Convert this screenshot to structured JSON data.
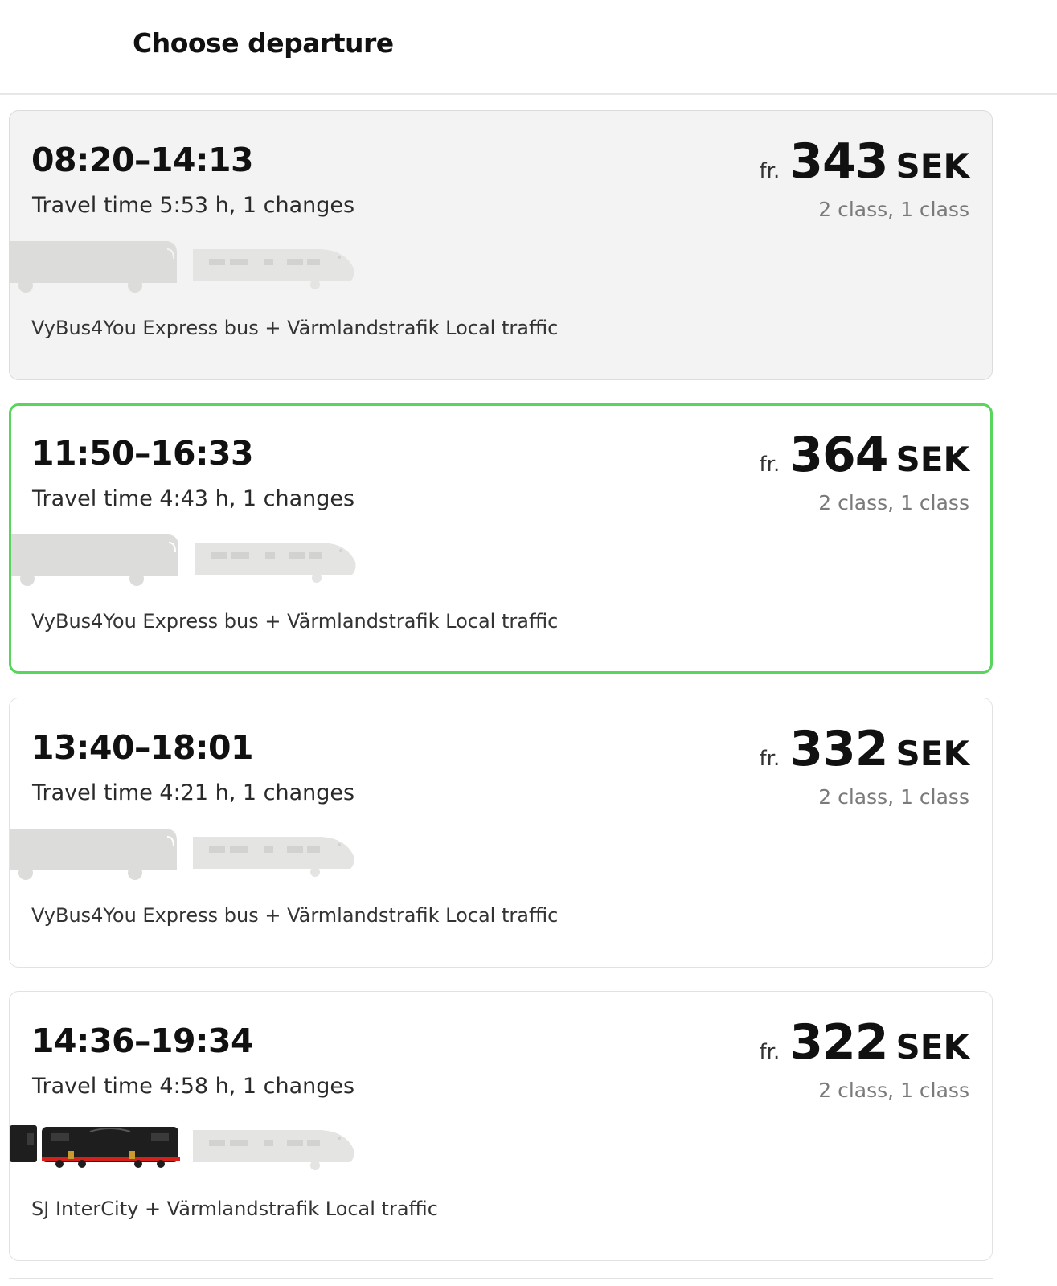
{
  "header": {
    "title": "Choose departure"
  },
  "departures": [
    {
      "times": "08:20–14:13",
      "duration": "Travel time 5:53 h, 1 changes",
      "price_prefix": "fr.",
      "price": "343",
      "currency": "SEK",
      "classes": "2 class, 1 class",
      "operators": "VyBus4You Express bus + Värmlandstrafik Local traffic",
      "vehicles": [
        "bus-icon",
        "train-icon"
      ],
      "state": "shaded"
    },
    {
      "times": "11:50–16:33",
      "duration": "Travel time 4:43 h, 1 changes",
      "price_prefix": "fr.",
      "price": "364",
      "currency": "SEK",
      "classes": "2 class, 1 class",
      "operators": "VyBus4You Express bus + Värmlandstrafik Local traffic",
      "vehicles": [
        "bus-icon",
        "train-icon"
      ],
      "state": "selected"
    },
    {
      "times": "13:40–18:01",
      "duration": "Travel time 4:21 h, 1 changes",
      "price_prefix": "fr.",
      "price": "332",
      "currency": "SEK",
      "classes": "2 class, 1 class",
      "operators": "VyBus4You Express bus + Värmlandstrafik Local traffic",
      "vehicles": [
        "bus-icon",
        "train-icon"
      ],
      "state": "default"
    },
    {
      "times": "14:36–19:34",
      "duration": "Travel time 4:58 h, 1 changes",
      "price_prefix": "fr.",
      "price": "322",
      "currency": "SEK",
      "classes": "2 class, 1 class",
      "operators": "SJ InterCity + Värmlandstrafik Local traffic",
      "vehicles": [
        "locomotive-icon",
        "train-icon"
      ],
      "state": "default"
    }
  ],
  "colors": {
    "selected_border": "#59d45c",
    "shaded_background": "#f3f3f3",
    "vehicle_grey": "#dcdcda",
    "locomotive_dark": "#1e1e1e",
    "locomotive_accent": "#d8201a"
  }
}
